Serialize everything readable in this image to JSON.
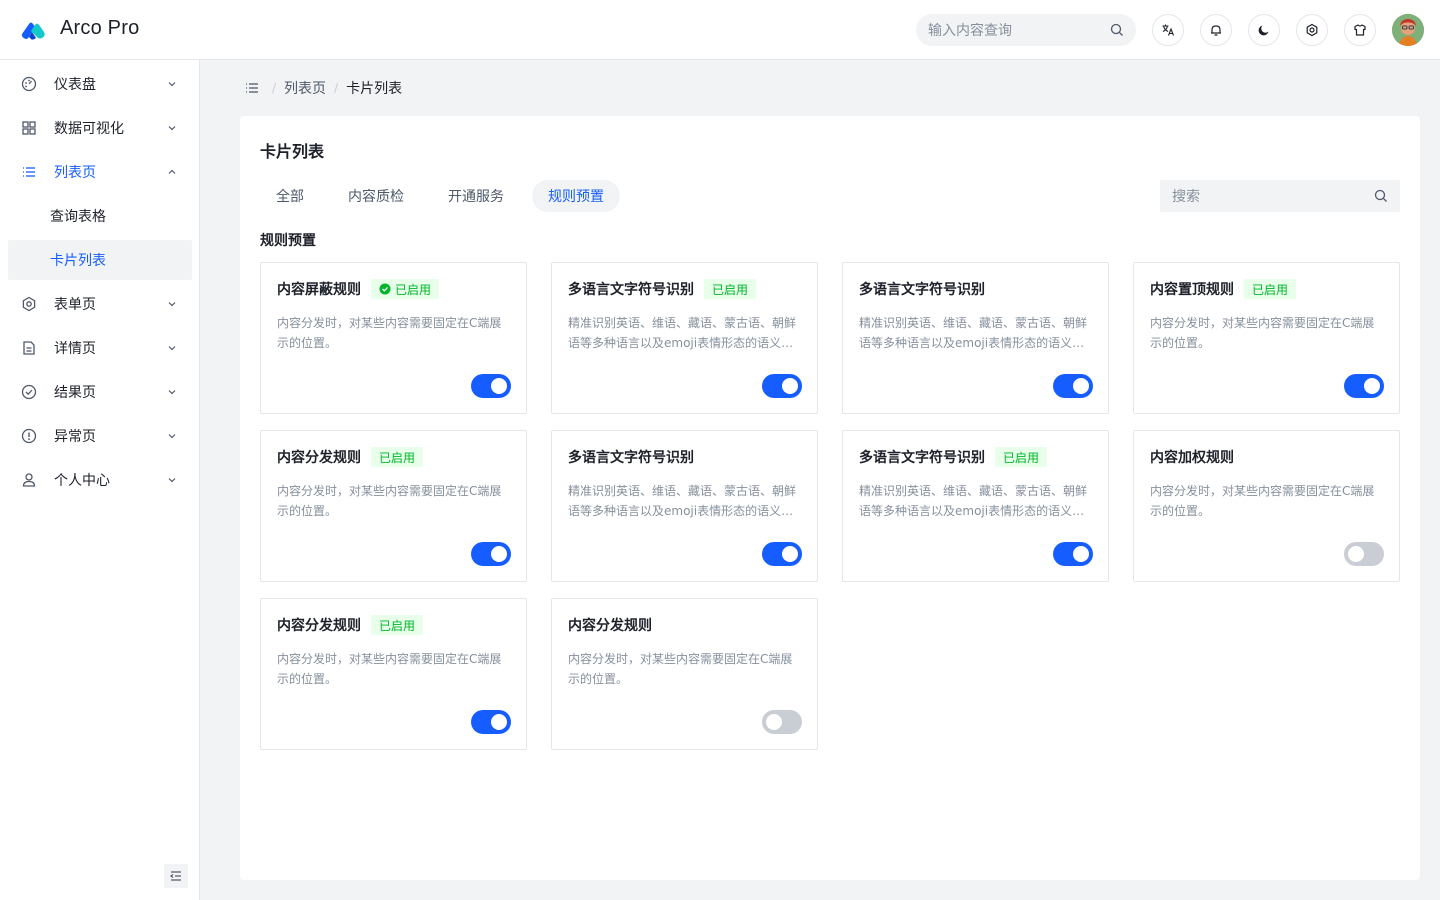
{
  "app": {
    "brand": "Arco Pro"
  },
  "header": {
    "search_placeholder": "输入内容查询",
    "icons": [
      "search-icon",
      "language-icon",
      "bell-icon",
      "moon-icon",
      "settings-icon",
      "tshirt-icon"
    ]
  },
  "sidebar": {
    "items": [
      {
        "label": "仪表盘",
        "icon": "dashboard-icon"
      },
      {
        "label": "数据可视化",
        "icon": "apps-icon"
      },
      {
        "label": "列表页",
        "icon": "list-icon"
      },
      {
        "label": "表单页",
        "icon": "settings-icon"
      },
      {
        "label": "详情页",
        "icon": "file-icon"
      },
      {
        "label": "结果页",
        "icon": "check-circle-icon"
      },
      {
        "label": "异常页",
        "icon": "exclamation-circle-icon"
      },
      {
        "label": "个人中心",
        "icon": "user-icon"
      }
    ],
    "sub_items": [
      "查询表格",
      "卡片列表"
    ]
  },
  "breadcrumb": [
    "列表页",
    "卡片列表"
  ],
  "panel": {
    "title": "卡片列表",
    "tabs": [
      "全部",
      "内容质检",
      "开通服务",
      "规则预置"
    ],
    "active_tab": "规则预置",
    "search_placeholder": "搜索",
    "section_title": "规则预置"
  },
  "cards": [
    {
      "title": "内容屏蔽规则",
      "tag": "已启用",
      "tag_icon": "check-circle-icon",
      "desc": "内容分发时，对某些内容需要固定在C端展示的位置。",
      "enabled": true
    },
    {
      "title": "多语言文字符号识别",
      "tag": "已启用",
      "desc": "精准识别英语、维语、藏语、蒙古语、朝鲜语等多种语言以及emoji表情形态的语义识别。",
      "enabled": true
    },
    {
      "title": "多语言文字符号识别",
      "tag": "",
      "desc": "精准识别英语、维语、藏语、蒙古语、朝鲜语等多种语言以及emoji表情形态的语义识别。",
      "enabled": true
    },
    {
      "title": "内容置顶规则",
      "tag": "已启用",
      "desc": "内容分发时，对某些内容需要固定在C端展示的位置。",
      "enabled": true
    },
    {
      "title": "内容分发规则",
      "tag": "已启用",
      "desc": "内容分发时，对某些内容需要固定在C端展示的位置。",
      "enabled": true
    },
    {
      "title": "多语言文字符号识别",
      "tag": "",
      "desc": "精准识别英语、维语、藏语、蒙古语、朝鲜语等多种语言以及emoji表情形态的语义识别。",
      "enabled": true
    },
    {
      "title": "多语言文字符号识别",
      "tag": "已启用",
      "desc": "精准识别英语、维语、藏语、蒙古语、朝鲜语等多种语言以及emoji表情形态的语义识别。",
      "enabled": true
    },
    {
      "title": "内容加权规则",
      "tag": "",
      "desc": "内容分发时，对某些内容需要固定在C端展示的位置。",
      "enabled": false
    },
    {
      "title": "内容分发规则",
      "tag": "已启用",
      "desc": "内容分发时，对某些内容需要固定在C端展示的位置。",
      "enabled": true
    },
    {
      "title": "内容分发规则",
      "tag": "",
      "desc": "内容分发时，对某些内容需要固定在C端展示的位置。",
      "enabled": false
    }
  ],
  "colors": {
    "primary": "#165dff",
    "success": "#00b42a",
    "success_bg": "#e8ffea",
    "switch_off": "#c9cdd4"
  }
}
